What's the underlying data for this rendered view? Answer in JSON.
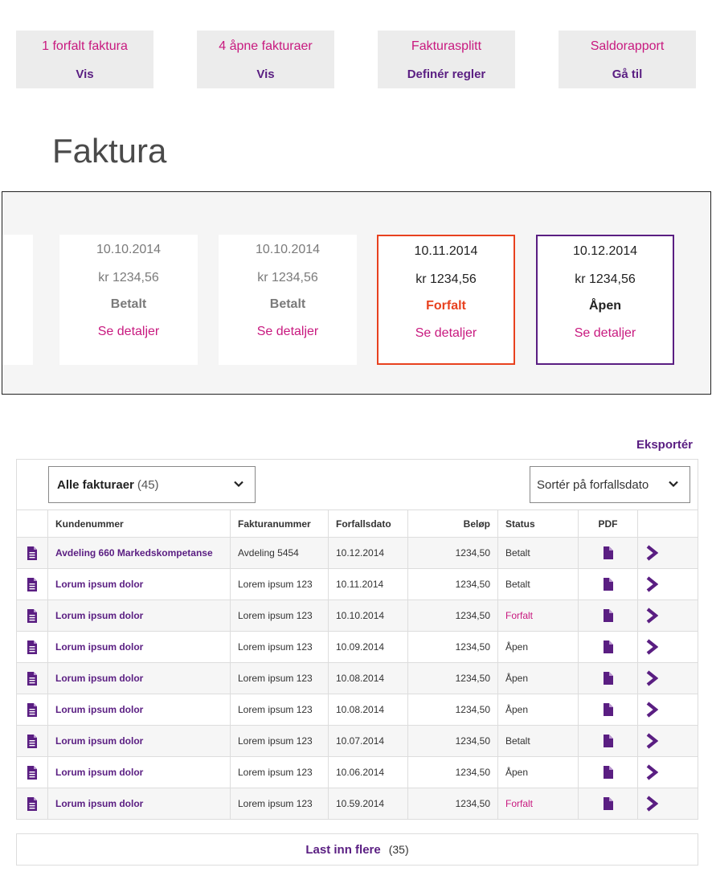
{
  "summary_tiles": [
    {
      "title": "1 forfalt faktura",
      "action": "Vis"
    },
    {
      "title": "4 åpne fakturaer",
      "action": "Vis"
    },
    {
      "title": "Fakturasplitt",
      "action": "Definér regler"
    },
    {
      "title": "Saldorapport",
      "action": "Gå til"
    }
  ],
  "page_title": "Faktura",
  "cards": [
    {
      "date": "10.10.2014",
      "amount": "kr 1234,56",
      "status": "Betalt",
      "link": "Se detaljer"
    },
    {
      "date": "10.10.2014",
      "amount": "kr 1234,56",
      "status": "Betalt",
      "link": "Se detaljer"
    },
    {
      "date": "10.11.2014",
      "amount": "kr 1234,56",
      "status": "Forfalt",
      "link": "Se detaljer"
    },
    {
      "date": "10.12.2014",
      "amount": "kr 1234,56",
      "status": "Åpen",
      "link": "Se detaljer"
    }
  ],
  "export_label": "Eksportér",
  "filter": {
    "label": "Alle fakturaer",
    "count": "(45)"
  },
  "sort": {
    "label": "Sortér på forfallsdato"
  },
  "table": {
    "headers": [
      "Kundenummer",
      "Fakturanummer",
      "Forfallsdato",
      "Beløp",
      "Status",
      "PDF"
    ],
    "rows": [
      [
        "Avdeling 660 Markedskompetanse",
        "Avdeling 5454",
        "10.12.2014",
        "1234,50",
        "Betalt"
      ],
      [
        "Lorum ipsum dolor",
        "Lorem ipsum 123",
        "10.11.2014",
        "1234,50",
        "Betalt"
      ],
      [
        "Lorum ipsum dolor",
        "Lorem ipsum 123",
        "10.10.2014",
        "1234,50",
        "Forfalt"
      ],
      [
        "Lorum ipsum dolor",
        "Lorem ipsum 123",
        "10.09.2014",
        "1234,50",
        "Åpen"
      ],
      [
        "Lorum ipsum dolor",
        "Lorem ipsum 123",
        "10.08.2014",
        "1234,50",
        "Åpen"
      ],
      [
        "Lorum ipsum dolor",
        "Lorem ipsum 123",
        "10.08.2014",
        "1234,50",
        "Åpen"
      ],
      [
        "Lorum ipsum dolor",
        "Lorem ipsum 123",
        "10.07.2014",
        "1234,50",
        "Betalt"
      ],
      [
        "Lorum ipsum dolor",
        "Lorem ipsum 123",
        "10.06.2014",
        "1234,50",
        "Åpen"
      ],
      [
        "Lorum ipsum dolor",
        "Lorem ipsum 123",
        "10.59.2014",
        "1234,50",
        "Forfalt"
      ]
    ]
  },
  "load_more": {
    "label": "Last inn flere",
    "count": "(35)"
  },
  "colors": {
    "brand_purple": "#5a1e82",
    "accent_pink": "#c8197f",
    "overdue_red": "#e8411f"
  },
  "icons": {
    "row_icon": "document-lines-icon",
    "pdf_icon": "pdf-file-icon",
    "row_action_icon": "chevron-right-icon",
    "dropdown_icon": "chevron-down-icon"
  }
}
